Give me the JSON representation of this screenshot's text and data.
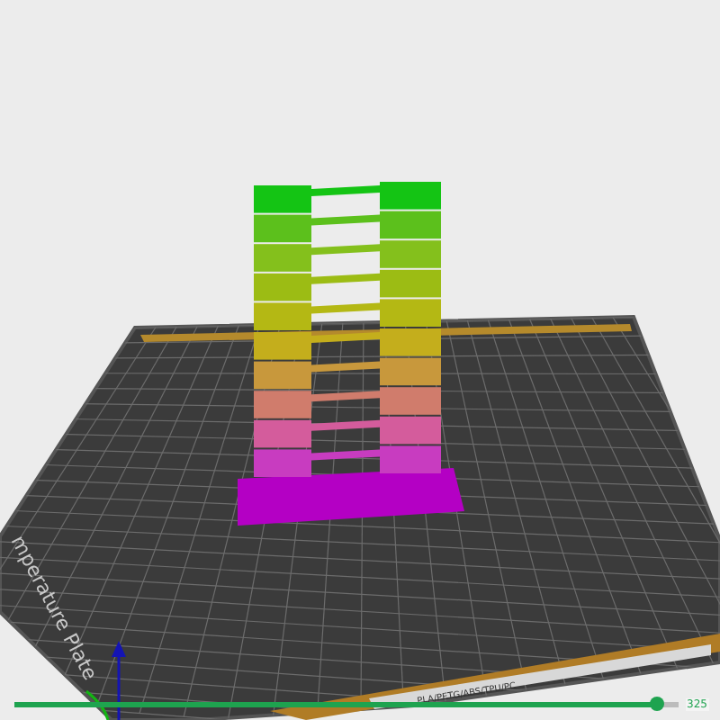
{
  "plate": {
    "side_label": "mperature Plate",
    "front_label": "PLA/PETG/ABS/TPU/PC"
  },
  "layer_slider": {
    "level": 0.97,
    "value": "325"
  }
}
